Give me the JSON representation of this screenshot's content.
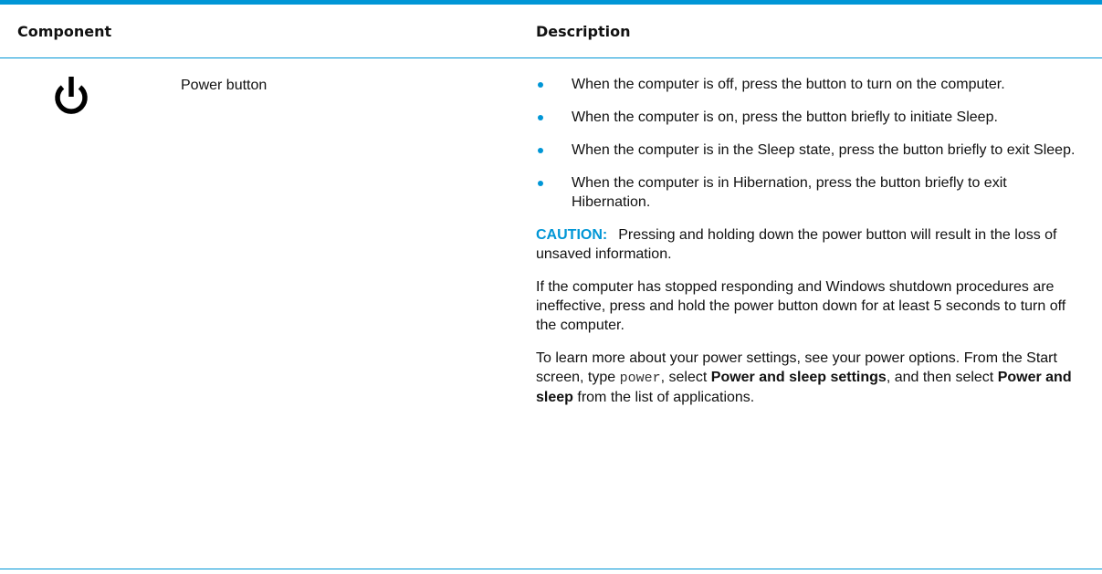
{
  "table": {
    "headers": {
      "component": "Component",
      "description": "Description"
    },
    "row": {
      "icon": "power-icon",
      "component_name": "Power button",
      "bullets": [
        "When the computer is off, press the button to turn on the computer.",
        "When the computer is on, press the button briefly to initiate Sleep.",
        "When the computer is in the Sleep state, press the button briefly to exit Sleep.",
        "When the computer is in Hibernation, press the button briefly to exit Hibernation."
      ],
      "caution": {
        "label": "CAUTION:",
        "text": "Pressing and holding down the power button will result in the loss of unsaved information."
      },
      "paragraph_1": "If the computer has stopped responding and Windows shutdown procedures are ineffective, press and hold the power button down for at least 5 seconds to turn off the computer.",
      "paragraph_2": {
        "part_1": "To learn more about your power settings, see your power options. From the Start screen, type ",
        "code": "power",
        "part_2": ", select ",
        "bold_1": "Power and sleep settings",
        "part_3": ", and then select ",
        "bold_2": "Power and sleep",
        "part_4": " from the list of applications."
      }
    }
  },
  "colors": {
    "accent": "#0096d6",
    "text": "#111111"
  }
}
